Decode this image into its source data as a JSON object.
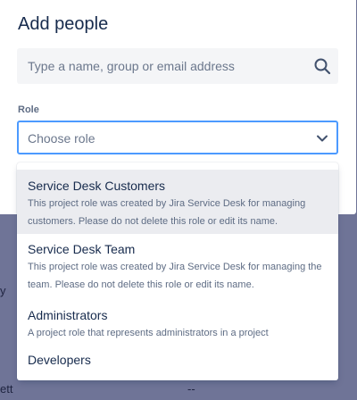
{
  "modal": {
    "title": "Add people",
    "search_placeholder": "Type a name, group or email address",
    "role_label": "Role",
    "role_placeholder": "Choose role"
  },
  "roles": [
    {
      "name": "Service Desk Customers",
      "description": "This project role was created by Jira Service Desk for managing customers. Please do not delete this role or edit its name."
    },
    {
      "name": "Service Desk Team",
      "description": "This project role was created by Jira Service Desk for managing the team. Please do not delete this role or edit its name."
    },
    {
      "name": "Administrators",
      "description": "A project role that represents administrators in a project"
    },
    {
      "name": "Developers",
      "description": ""
    }
  ],
  "background": {
    "left_fragment": "y",
    "bottom_left_fragment": "ett",
    "bottom_mid_fragment": "--"
  },
  "colors": {
    "focus_border": "#4c9aff",
    "highlight": "#ebecf0",
    "overlay": "#6f7497"
  }
}
